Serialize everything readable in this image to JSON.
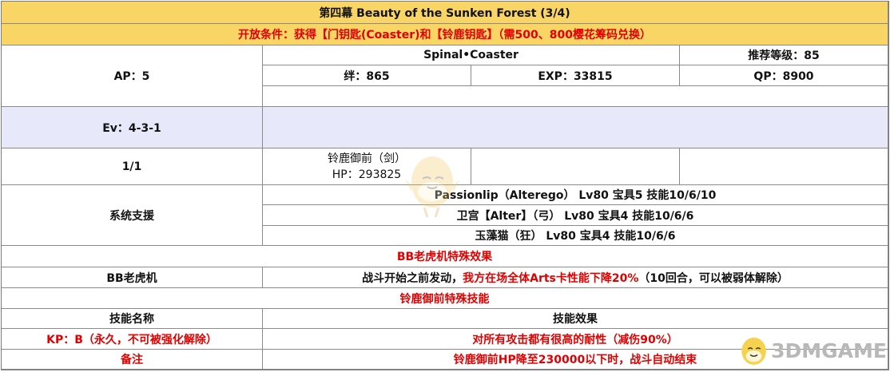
{
  "title": "第四幕 Beauty of the Sunken Forest (3/4)",
  "condition": "开放条件：获得【门钥匙(Coaster)和【铃鹿钥匙】（需500、800樱花筹码兑换）",
  "info": {
    "ap": "AP：5",
    "quest_name": "Spinal•Coaster",
    "rec_level": "推荐等级：85",
    "bond": "绊：865",
    "exp": "EXP：33815",
    "qp": "QP：8900"
  },
  "ev": "Ev：4-3-1",
  "wave": {
    "label": "1/1",
    "enemy_name": "铃鹿御前（剑）",
    "enemy_hp": "HP：293825"
  },
  "support": {
    "label": "系统支援",
    "rows": [
      "Passionlip（Alterego） Lv80 宝具5 技能10/6/10",
      "卫宫【Alter】（弓） Lv80 宝具4 技能10/6/6",
      "玉藻猫（狂） Lv80 宝具4 技能10/6/6"
    ]
  },
  "bb": {
    "header": "BB老虎机特殊效果",
    "label": "BB老虎机",
    "effect_black": "战斗开始之前发动，",
    "effect_red": "我方在场全体Arts卡性能下降20%",
    "effect_tail": "（10回合，可以被弱体解除）"
  },
  "skill": {
    "header": "铃鹿御前特殊技能",
    "col_name": "技能名称",
    "col_effect": "技能效果",
    "name": "KP：B（永久，不可被强化解除）",
    "effect": "对所有攻击都有很高的耐性（减伤90%）"
  },
  "note": {
    "label": "备注",
    "text": "铃鹿御前HP降至230000以下时，战斗自动结束"
  },
  "watermark": "3DMGAME",
  "colors": {
    "header_bg": "#f9d565",
    "ev_bg": "#e8e8fb",
    "red": "#e10000"
  }
}
